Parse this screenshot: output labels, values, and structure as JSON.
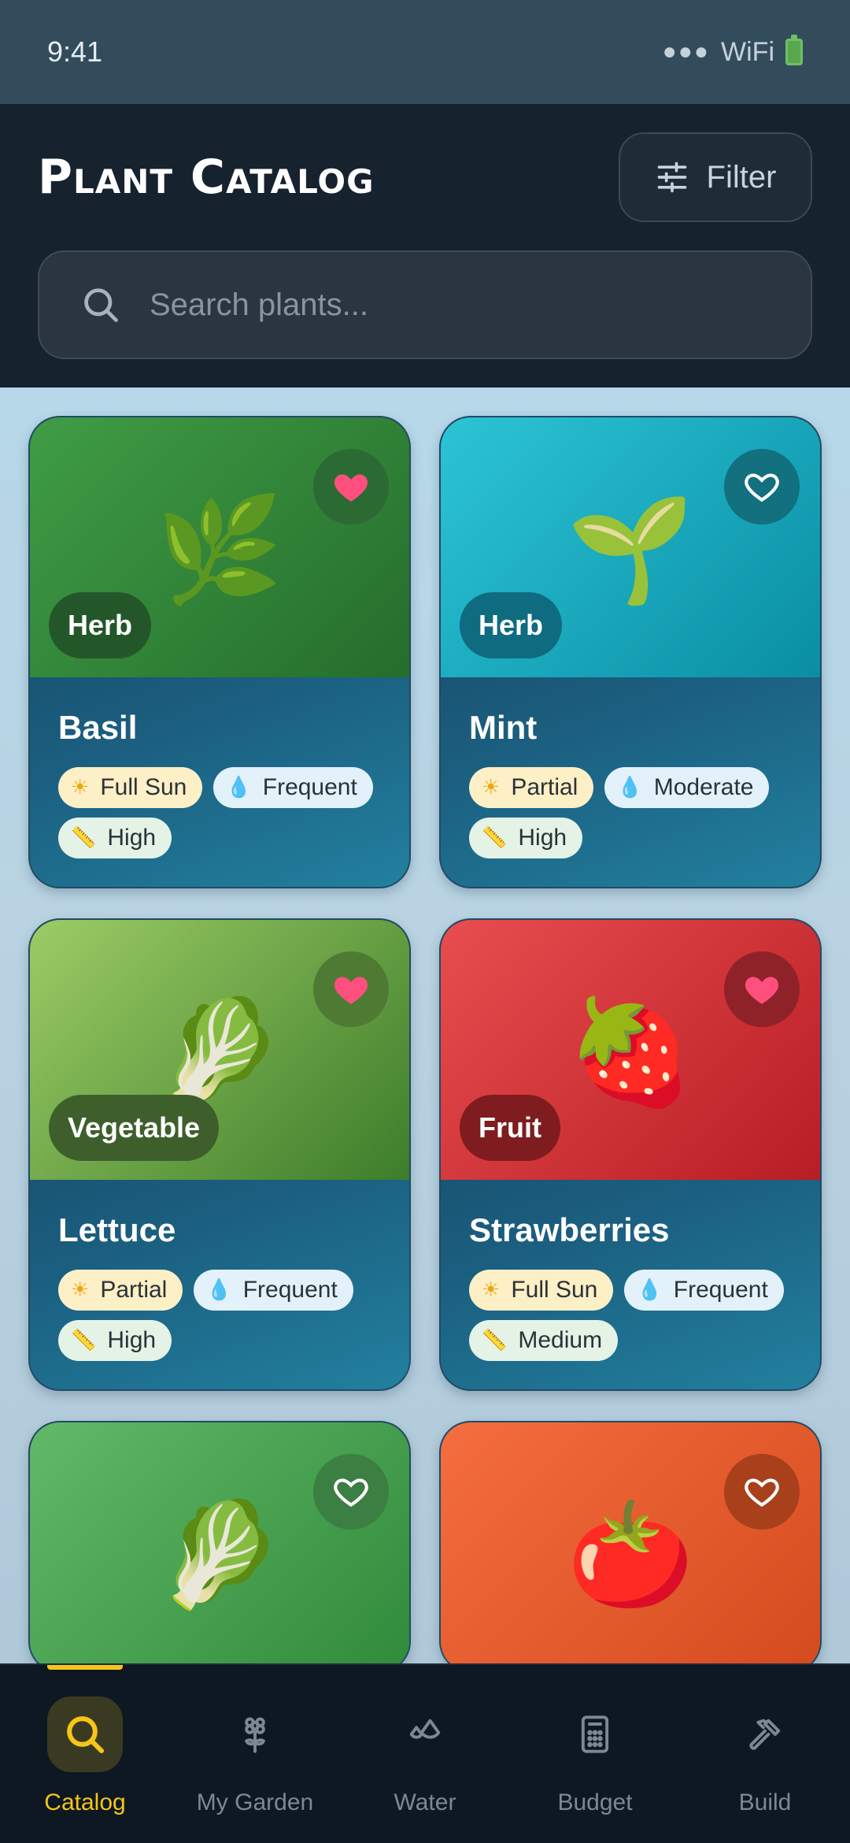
{
  "status_bar": {
    "time": "9:41",
    "signal": "●●●",
    "wifi": "WiFi"
  },
  "header": {
    "title": "Plant Catalog",
    "filter_label": "Filter",
    "search_placeholder": "Search plants..."
  },
  "colors": {
    "accent": "#f5c518",
    "favorite": "#ff4f7e",
    "header_bg": "#16222e",
    "nav_bg": "#0e1822"
  },
  "plants": [
    {
      "name": "Basil",
      "category": "Herb",
      "emoji": "🌿",
      "favorite": true,
      "sun": "Full Sun",
      "water": "Frequent",
      "difficulty": "High",
      "bg": "linear-gradient(135deg,#3f9d45,#256d2c)",
      "badge_bg": "#23572a",
      "fav_bg": "#2c6a33"
    },
    {
      "name": "Mint",
      "category": "Herb",
      "emoji": "🌱",
      "favorite": false,
      "sun": "Partial",
      "water": "Moderate",
      "difficulty": "High",
      "bg": "linear-gradient(135deg,#2cc4d6,#0a8ea4)",
      "badge_bg": "#0f6c80",
      "fav_bg": "#12707f"
    },
    {
      "name": "Lettuce",
      "category": "Vegetable",
      "emoji": "🥬",
      "favorite": true,
      "sun": "Partial",
      "water": "Frequent",
      "difficulty": "High",
      "bg": "linear-gradient(135deg,#9ccc65,#3d7d2a)",
      "badge_bg": "#3e5f2c",
      "fav_bg": "#4f7a34"
    },
    {
      "name": "Strawberries",
      "category": "Fruit",
      "emoji": "🍓",
      "favorite": true,
      "sun": "Full Sun",
      "water": "Frequent",
      "difficulty": "Medium",
      "bg": "linear-gradient(135deg,#e84d4f,#b81d24)",
      "badge_bg": "#7f1c20",
      "fav_bg": "#8f2228"
    },
    {
      "name": "",
      "category": "",
      "emoji": "🥬",
      "favorite": false,
      "sun": "",
      "water": "",
      "difficulty": "",
      "bg": "linear-gradient(135deg,#62b967,#2f8a3a)",
      "badge_bg": "#2b5e31",
      "fav_bg": "#3b7f43"
    },
    {
      "name": "",
      "category": "",
      "emoji": "🍅",
      "favorite": false,
      "sun": "",
      "water": "",
      "difficulty": "",
      "bg": "linear-gradient(135deg,#f56e3f,#d44a1e)",
      "badge_bg": "#8a2e14",
      "fav_bg": "#a8401c"
    }
  ],
  "nav": [
    {
      "label": "Catalog",
      "icon": "search-icon",
      "active": true
    },
    {
      "label": "My Garden",
      "icon": "flower-icon",
      "active": false
    },
    {
      "label": "Water",
      "icon": "droplets-icon",
      "active": false
    },
    {
      "label": "Budget",
      "icon": "calculator-icon",
      "active": false
    },
    {
      "label": "Build",
      "icon": "hammer-icon",
      "active": false
    }
  ]
}
